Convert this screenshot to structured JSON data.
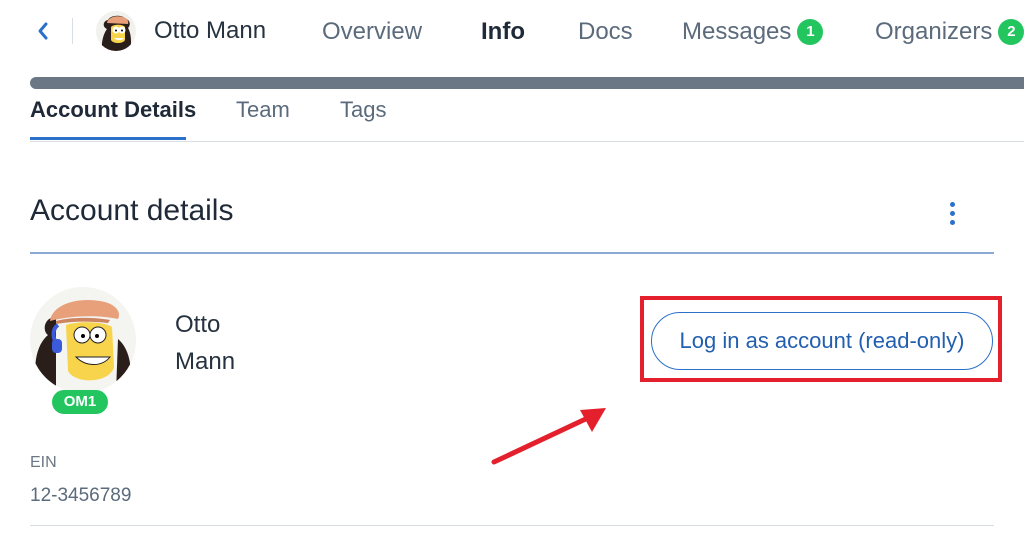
{
  "header": {
    "name": "Otto Mann",
    "tabs": [
      {
        "label": "Overview"
      },
      {
        "label": "Info",
        "active": true
      },
      {
        "label": "Docs"
      },
      {
        "label": "Messages",
        "badge": "1"
      },
      {
        "label": "Organizers",
        "badge": "2"
      }
    ]
  },
  "progress": {
    "value": 1.0
  },
  "subtabs": [
    {
      "label": "Account Details",
      "active": true
    },
    {
      "label": "Team"
    },
    {
      "label": "Tags"
    }
  ],
  "section": {
    "title": "Account details"
  },
  "account": {
    "first_name": "Otto",
    "last_name": "Mann",
    "initials": "OM1",
    "login_button": "Log in as account (read-only)",
    "ein_label": "EIN",
    "ein_value": "12-3456789"
  },
  "colors": {
    "accent": "#2b70c9",
    "badge": "#22c55e",
    "highlight": "#e4202c",
    "progress": "#6b7785"
  },
  "icons": {
    "back": "chevron-left-icon",
    "more": "kebab-icon"
  }
}
